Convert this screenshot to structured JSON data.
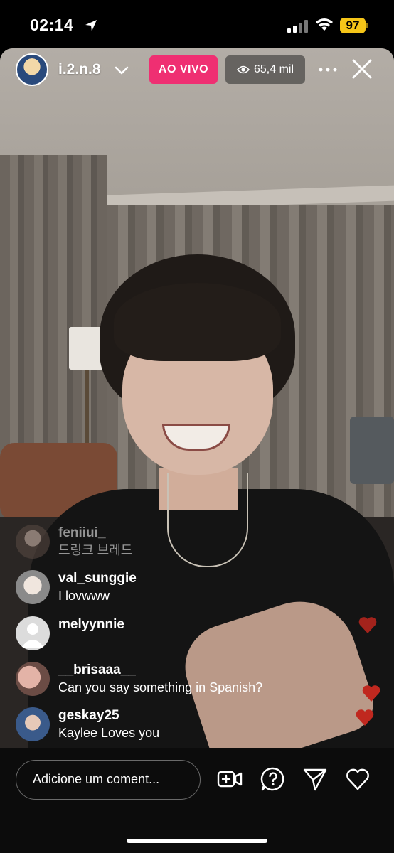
{
  "status_bar": {
    "time": "02:14",
    "battery": "97"
  },
  "live": {
    "username": "i.2.n.8",
    "live_badge": "AO VIVO",
    "viewers": "65,4 mil"
  },
  "comments": [
    {
      "user": "feniiui_",
      "text": "드링크 브레드"
    },
    {
      "user": "val_sunggie",
      "text": "I lovwww"
    },
    {
      "user": "melyynnie",
      "text": ""
    },
    {
      "user": "__brisaaa__",
      "text": "Can you say something in Spanish?"
    },
    {
      "user": "geskay25",
      "text": "Kaylee Loves you"
    }
  ],
  "composer": {
    "placeholder": "Adicione um coment..."
  },
  "colors": {
    "live_badge": "#ef2f72",
    "heart": "#c0281f",
    "battery": "#f5c518"
  },
  "icons": [
    "location-arrow-icon",
    "signal-icon",
    "wifi-icon",
    "chevron-down-icon",
    "eye-icon",
    "more-icon",
    "close-icon",
    "add-video-icon",
    "question-icon",
    "share-icon",
    "like-icon",
    "heart-icon"
  ]
}
